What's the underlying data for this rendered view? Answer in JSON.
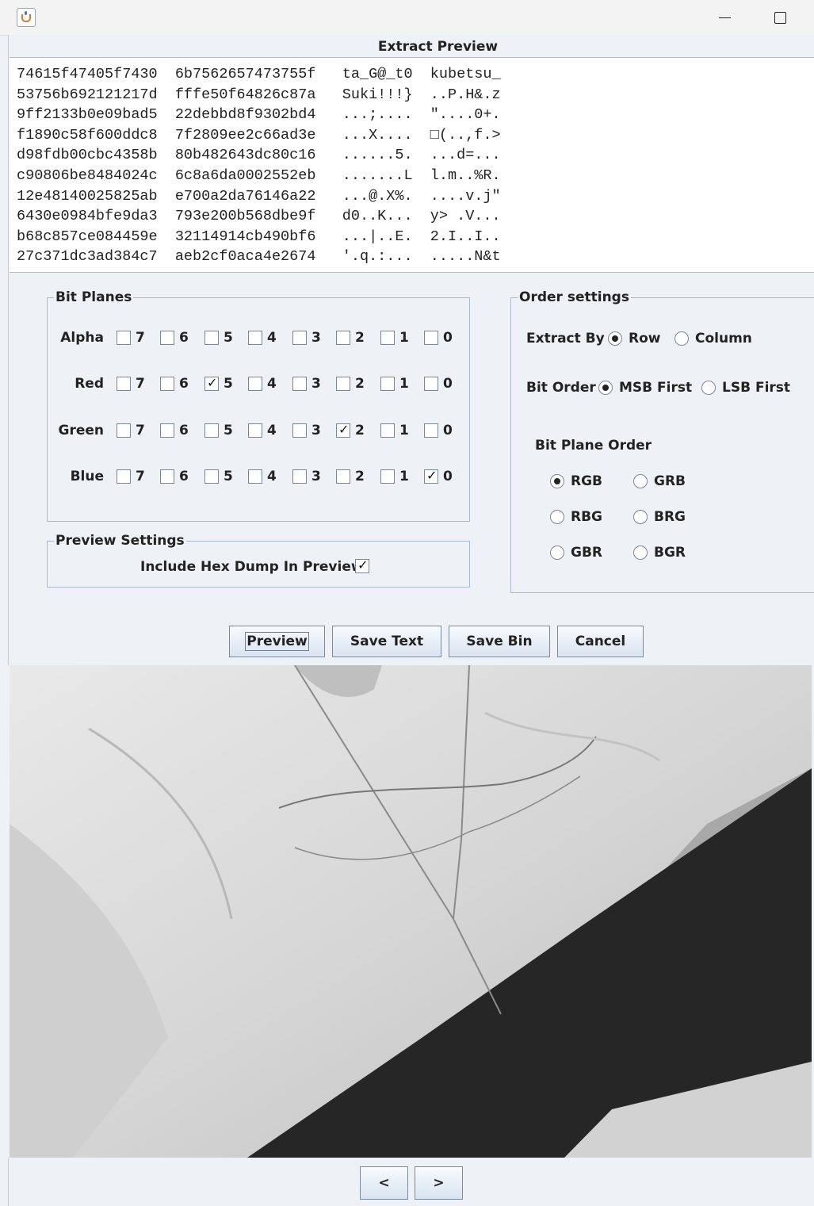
{
  "window": {
    "icon": "java-cup-icon"
  },
  "dialog": {
    "title": "Extract Preview",
    "hex_lines": [
      "74615f47405f7430  6b7562657473755f   ta_G@_t0  kubetsu_",
      "53756b692121217d  fffe50f64826c87a   Suki!!!}  ..P.H&.z",
      "9ff2133b0e09bad5  22debbd8f9302bd4   ...;....  \"....0+.",
      "f1890c58f600ddc8  7f2809ee2c66ad3e   ...X....  □(..,f.>",
      "d98fdb00cbc4358b  80b482643dc80c16   ......5.  ...d=...",
      "c90806be8484024c  6c8a6da0002552eb   .......L  l.m..%R.",
      "12e48140025825ab  e700a2da76146a22   ...@.X%.  ....v.j\"",
      "6430e0984bfe9da3  793e200b568dbe9f   d0..K...  y> .V...",
      "b68c857ce084459e  32114914cb490bf6   ...|..E.  2.I..I..",
      "27c371dc3ad384c7  aeb2cf0aca4e2674   '.q.:...  .....N&t"
    ],
    "bit_planes": {
      "title": "Bit Planes",
      "bits": [
        "7",
        "6",
        "5",
        "4",
        "3",
        "2",
        "1",
        "0"
      ],
      "rows": [
        {
          "label": "Alpha",
          "checked": []
        },
        {
          "label": "Red",
          "checked": [
            "5"
          ]
        },
        {
          "label": "Green",
          "checked": [
            "2"
          ]
        },
        {
          "label": "Blue",
          "checked": [
            "0"
          ]
        }
      ]
    },
    "preview_settings": {
      "title": "Preview Settings",
      "hex_dump_label": "Include Hex Dump In Preview",
      "hex_dump_checked": true
    },
    "order_settings": {
      "title": "Order settings",
      "extract_by": {
        "label": "Extract By",
        "options": [
          "Row",
          "Column"
        ],
        "selected": "Row"
      },
      "bit_order": {
        "label": "Bit Order",
        "options": [
          "MSB First",
          "LSB First"
        ],
        "selected": "MSB First"
      },
      "plane_order": {
        "label": "Bit Plane Order",
        "options": [
          "RGB",
          "GRB",
          "RBG",
          "BRG",
          "GBR",
          "BGR"
        ],
        "selected": "RGB"
      }
    },
    "buttons": {
      "preview": "Preview",
      "save_text": "Save Text",
      "save_bin": "Save Bin",
      "cancel": "Cancel"
    }
  },
  "nav": {
    "prev": "<",
    "next": ">"
  }
}
